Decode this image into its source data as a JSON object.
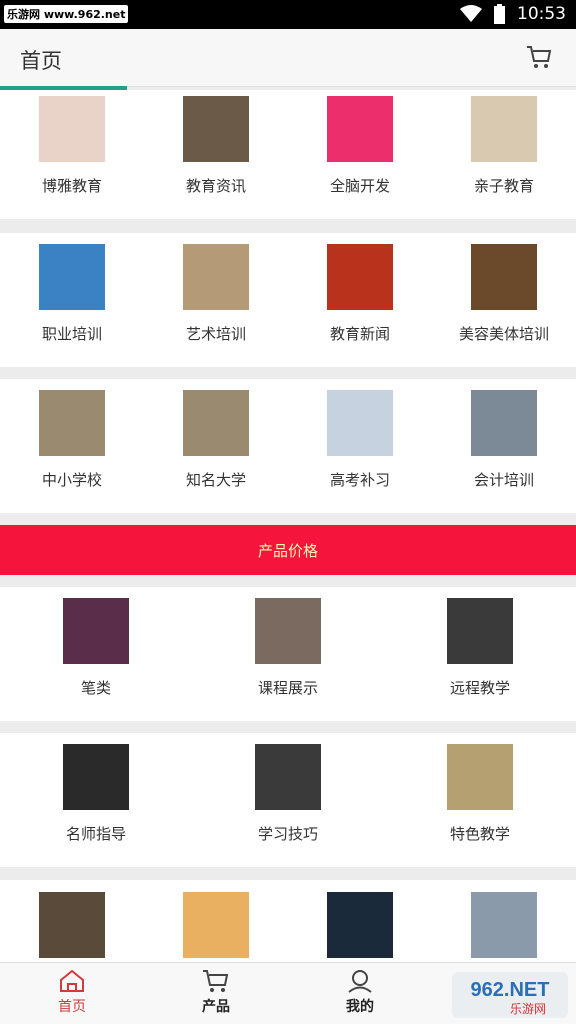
{
  "status": {
    "watermark": "乐游网 www.962.net",
    "time": "10:53"
  },
  "header": {
    "title": "首页"
  },
  "rows": [
    {
      "items": [
        {
          "label": "博雅教育",
          "thumb_color": "#e9d3c8"
        },
        {
          "label": "教育资讯",
          "thumb_color": "#6b5a48"
        },
        {
          "label": "全脑开发",
          "thumb_color": "#ec2f6c"
        },
        {
          "label": "亲子教育",
          "thumb_color": "#d9c9b0"
        }
      ]
    },
    {
      "items": [
        {
          "label": "职业培训",
          "thumb_color": "#3a82c4"
        },
        {
          "label": "艺术培训",
          "thumb_color": "#b59a78"
        },
        {
          "label": "教育新闻",
          "thumb_color": "#b8321c"
        },
        {
          "label": "美容美体培训",
          "thumb_color": "#6a4a2a"
        }
      ]
    },
    {
      "items": [
        {
          "label": "中小学校",
          "thumb_color": "#9a8a70"
        },
        {
          "label": "知名大学",
          "thumb_color": "#9a8a70"
        },
        {
          "label": "高考补习",
          "thumb_color": "#c6d2e0"
        },
        {
          "label": "会计培训",
          "thumb_color": "#7b8a96"
        }
      ]
    }
  ],
  "banner": {
    "label": "产品价格"
  },
  "rows3": [
    {
      "items": [
        {
          "label": "笔类",
          "thumb_color": "#5a2e4a"
        },
        {
          "label": "课程展示",
          "thumb_color": "#7a6a60"
        },
        {
          "label": "远程教学",
          "thumb_color": "#3a3a3a"
        }
      ]
    },
    {
      "items": [
        {
          "label": "名师指导",
          "thumb_color": "#2a2a2a"
        },
        {
          "label": "学习技巧",
          "thumb_color": "#3a3a3a"
        },
        {
          "label": "特色教学",
          "thumb_color": "#b4a070"
        }
      ]
    }
  ],
  "row_last": {
    "items": [
      {
        "thumb_color": "#5a4a3a"
      },
      {
        "thumb_color": "#e8b060"
      },
      {
        "thumb_color": "#1a2a3a"
      },
      {
        "thumb_color": "#8a9aaa"
      }
    ]
  },
  "tabbar": [
    {
      "label": "首页",
      "icon": "home-icon"
    },
    {
      "label": "产品",
      "icon": "cart-icon"
    },
    {
      "label": "我的",
      "icon": "user-icon"
    },
    {
      "label": "",
      "icon": "logo"
    }
  ],
  "overlay_logo": {
    "text": "962.NET",
    "sub": "乐游网"
  }
}
